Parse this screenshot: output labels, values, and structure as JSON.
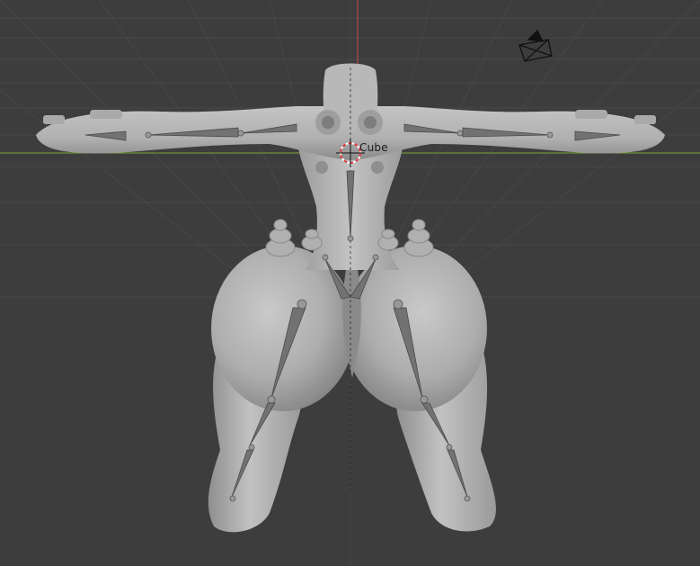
{
  "viewport": {
    "object_label": "Cube",
    "colors": {
      "background": "#3d3d3d",
      "grid_line": "#474747",
      "x_axis": "#7aa33b",
      "z_axis": "#c84b4b",
      "mesh_light": "#bdbdbd",
      "mesh_shadow": "#8c8c8c",
      "bone": "#6f6f6f",
      "cursor_red": "#e04040"
    }
  }
}
